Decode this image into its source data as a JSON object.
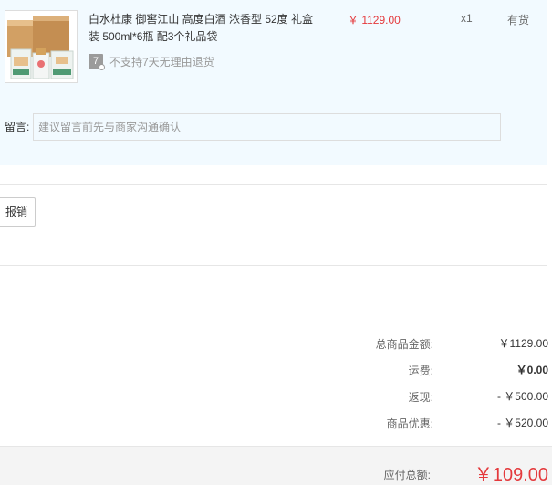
{
  "product": {
    "title": "白水杜康 御窖江山 高度白酒 浓香型 52度 礼盒装 500ml*6瓶 配3个礼品袋",
    "price": "￥ 1129.00",
    "quantity": "x1",
    "stock": "有货",
    "return_policy_icon": "7",
    "return_policy": "不支持7天无理由退货"
  },
  "remark": {
    "label": "留言:",
    "placeholder": "建议留言前先与商家沟通确认"
  },
  "reimburse_button": "报销",
  "summary": [
    {
      "label": "总商品金额:",
      "value": "￥1129.00"
    },
    {
      "label": "运费:",
      "value": "￥0.00"
    },
    {
      "label": "返现:",
      "value": "- ￥500.00"
    },
    {
      "label": "商品优惠:",
      "value": "- ￥520.00"
    }
  ],
  "total": {
    "label": "应付总额:",
    "value": "￥109.00"
  },
  "colors": {
    "accent": "#e4393c",
    "panel": "#f2faff"
  }
}
